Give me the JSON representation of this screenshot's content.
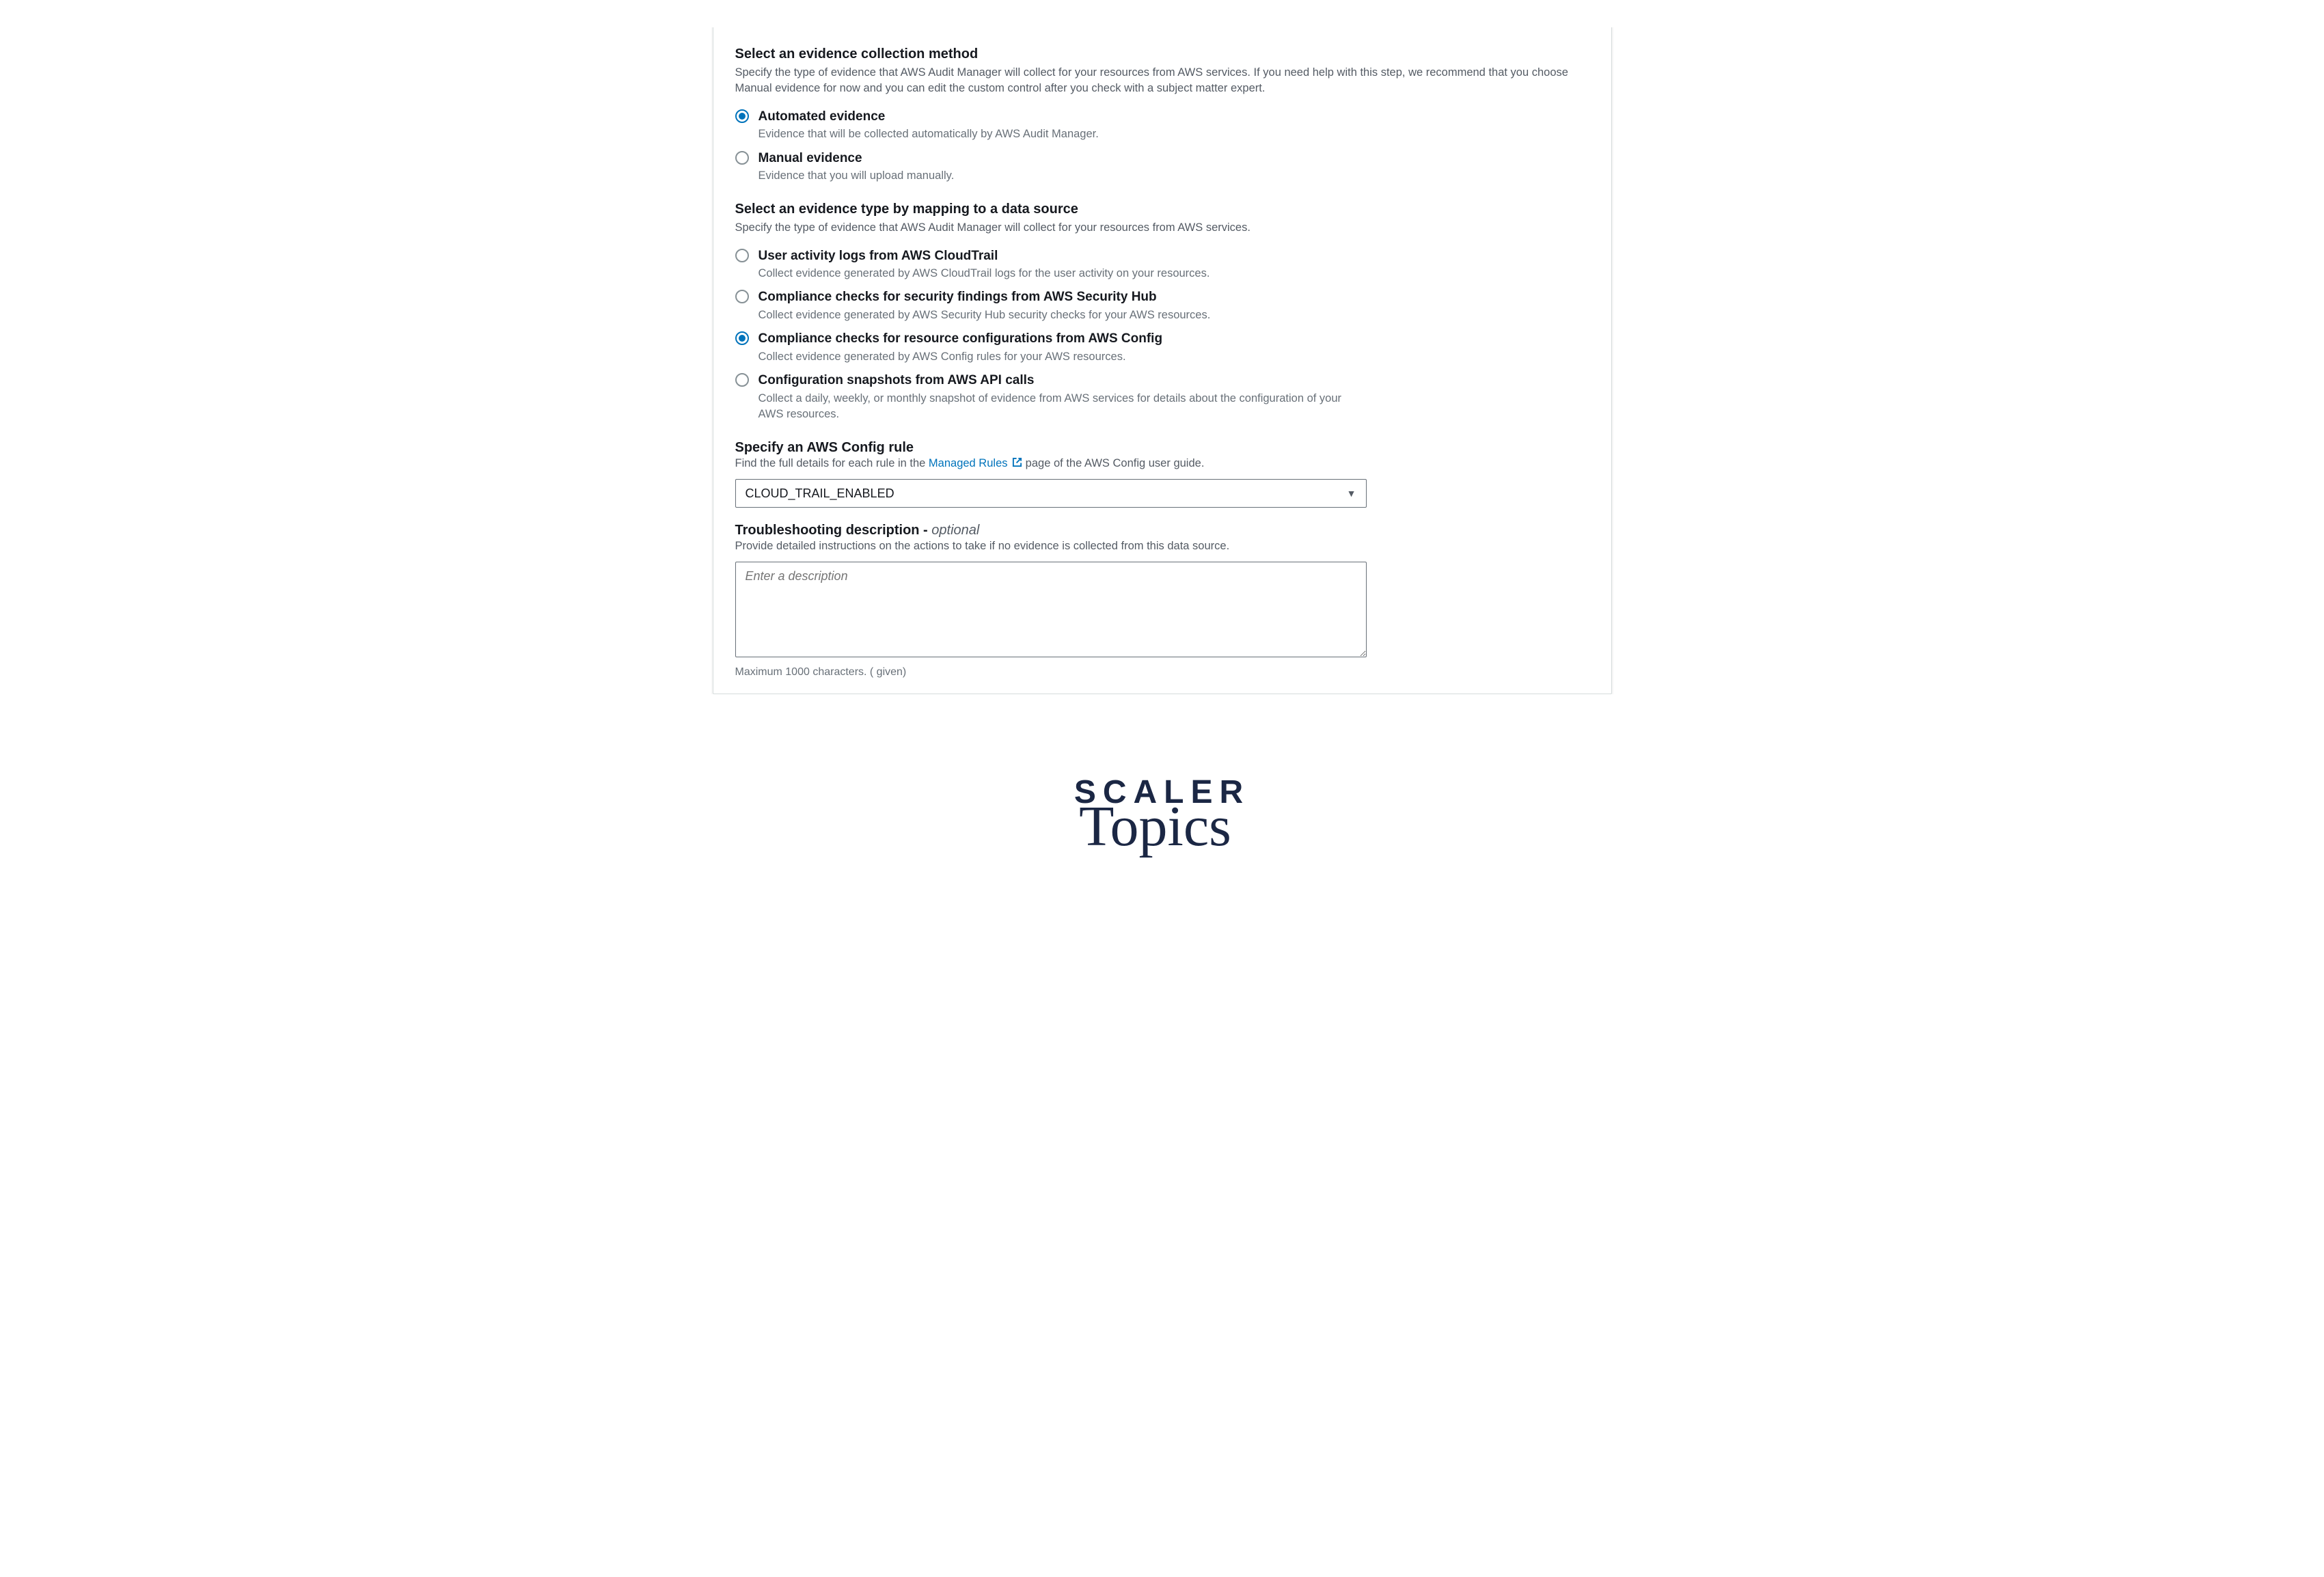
{
  "collection": {
    "title": "Select an evidence collection method",
    "desc": "Specify the type of evidence that AWS Audit Manager will collect for your resources from AWS services. If you need help with this step, we recommend that you choose Manual evidence for now and you can edit the custom control after you check with a subject matter expert.",
    "options": [
      {
        "label": "Automated evidence",
        "desc": "Evidence that will be collected automatically by AWS Audit Manager.",
        "selected": true
      },
      {
        "label": "Manual evidence",
        "desc": "Evidence that you will upload manually.",
        "selected": false
      }
    ]
  },
  "dataSource": {
    "title": "Select an evidence type by mapping to a data source",
    "desc": "Specify the type of evidence that AWS Audit Manager will collect for your resources from AWS services.",
    "options": [
      {
        "label": "User activity logs from AWS CloudTrail",
        "desc": "Collect evidence generated by AWS CloudTrail logs for the user activity on your resources.",
        "selected": false
      },
      {
        "label": "Compliance checks for security findings from AWS Security Hub",
        "desc": "Collect evidence generated by AWS Security Hub security checks for your AWS resources.",
        "selected": false
      },
      {
        "label": "Compliance checks for resource configurations from AWS Config",
        "desc": "Collect evidence generated by AWS Config rules for your AWS resources.",
        "selected": true
      },
      {
        "label": "Configuration snapshots from AWS API calls",
        "desc": "Collect a daily, weekly, or monthly snapshot of evidence from AWS services for details about the configuration of your AWS resources.",
        "selected": false
      }
    ]
  },
  "configRule": {
    "title": "Specify an AWS Config rule",
    "desc_before": "Find the full details for each rule in the ",
    "link_text": "Managed Rules",
    "desc_after": " page of the AWS Config user guide.",
    "selected": "CLOUD_TRAIL_ENABLED"
  },
  "troubleshoot": {
    "title": "Troubleshooting description - ",
    "optional": "optional",
    "desc": "Provide detailed instructions on the actions to take if no evidence is collected from this data source.",
    "placeholder": "Enter a description",
    "hint": "Maximum 1000 characters. ( given)"
  },
  "logo": {
    "line1": "SCALER",
    "line2": "Topics"
  }
}
